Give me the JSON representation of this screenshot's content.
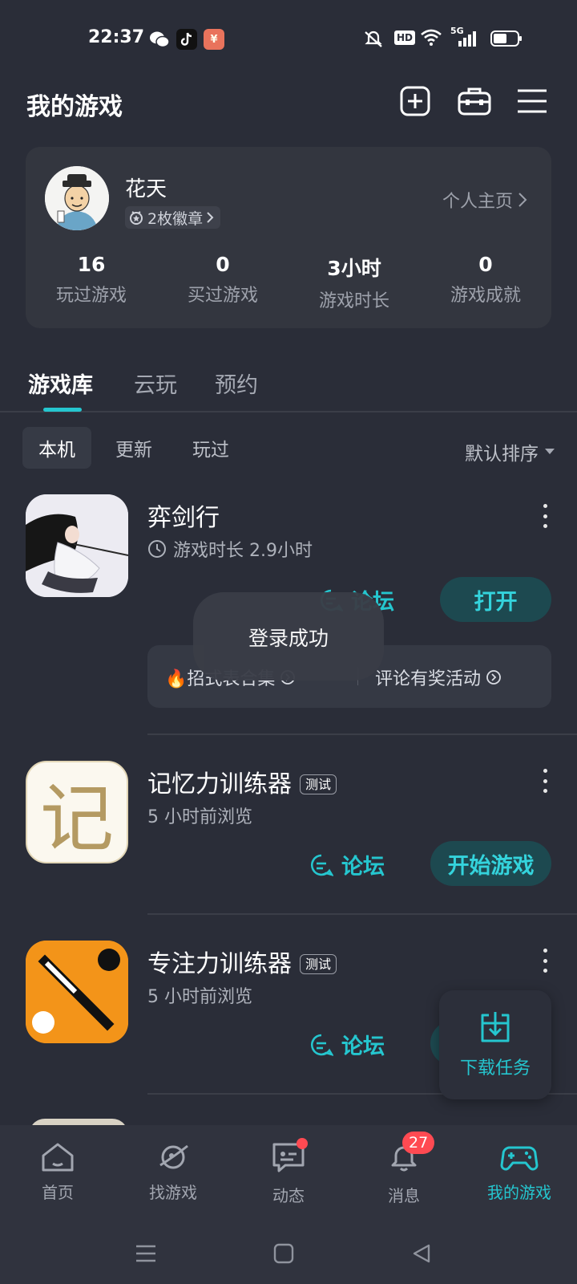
{
  "status_bar": {
    "time": "22:37",
    "hd_label": "HD",
    "network_label": "5G"
  },
  "header": {
    "title": "我的游戏"
  },
  "profile": {
    "username": "花天",
    "badges": "2枚徽章",
    "homepage_link": "个人主页",
    "stats": [
      {
        "value": "16",
        "label": "玩过游戏"
      },
      {
        "value": "0",
        "label": "买过游戏"
      },
      {
        "value": "3小时",
        "label": "游戏时长"
      },
      {
        "value": "0",
        "label": "游戏成就"
      }
    ]
  },
  "tabs": [
    {
      "label": "游戏库",
      "active": true
    },
    {
      "label": "云玩",
      "active": false
    },
    {
      "label": "预约",
      "active": false
    }
  ],
  "filters": {
    "chips": [
      {
        "label": "本机",
        "active": true
      },
      {
        "label": "更新",
        "active": false
      },
      {
        "label": "玩过",
        "active": false
      }
    ],
    "sort_label": "默认排序"
  },
  "games": [
    {
      "name": "弈剑行",
      "subtitle": "游戏时长 2.9小时",
      "forum_label": "论坛",
      "primary_label": "打开",
      "activities": [
        "🔥招式表合集",
        "评论有奖活动"
      ]
    },
    {
      "name": "记忆力训练器",
      "badge": "测试",
      "subtitle": "5 小时前浏览",
      "forum_label": "论坛",
      "primary_label": "开始游戏",
      "icon_glyph": "记"
    },
    {
      "name": "专注力训练器",
      "badge": "测试",
      "subtitle": "5 小时前浏览",
      "forum_label": "论坛"
    }
  ],
  "toast": {
    "message": "登录成功"
  },
  "download_task": {
    "label": "下载任务"
  },
  "bottom_nav": {
    "items": [
      {
        "label": "首页",
        "icon": "home-icon"
      },
      {
        "label": "找游戏",
        "icon": "planet-icon"
      },
      {
        "label": "动态",
        "icon": "chat-icon"
      },
      {
        "label": "消息",
        "icon": "bell-icon",
        "badge": "27"
      },
      {
        "label": "我的游戏",
        "icon": "gamepad-icon",
        "active": true
      }
    ]
  },
  "colors": {
    "background": "#2a2d38",
    "card": "#33363f",
    "accent": "#25c6cf",
    "badge_red": "#ff4a52"
  }
}
